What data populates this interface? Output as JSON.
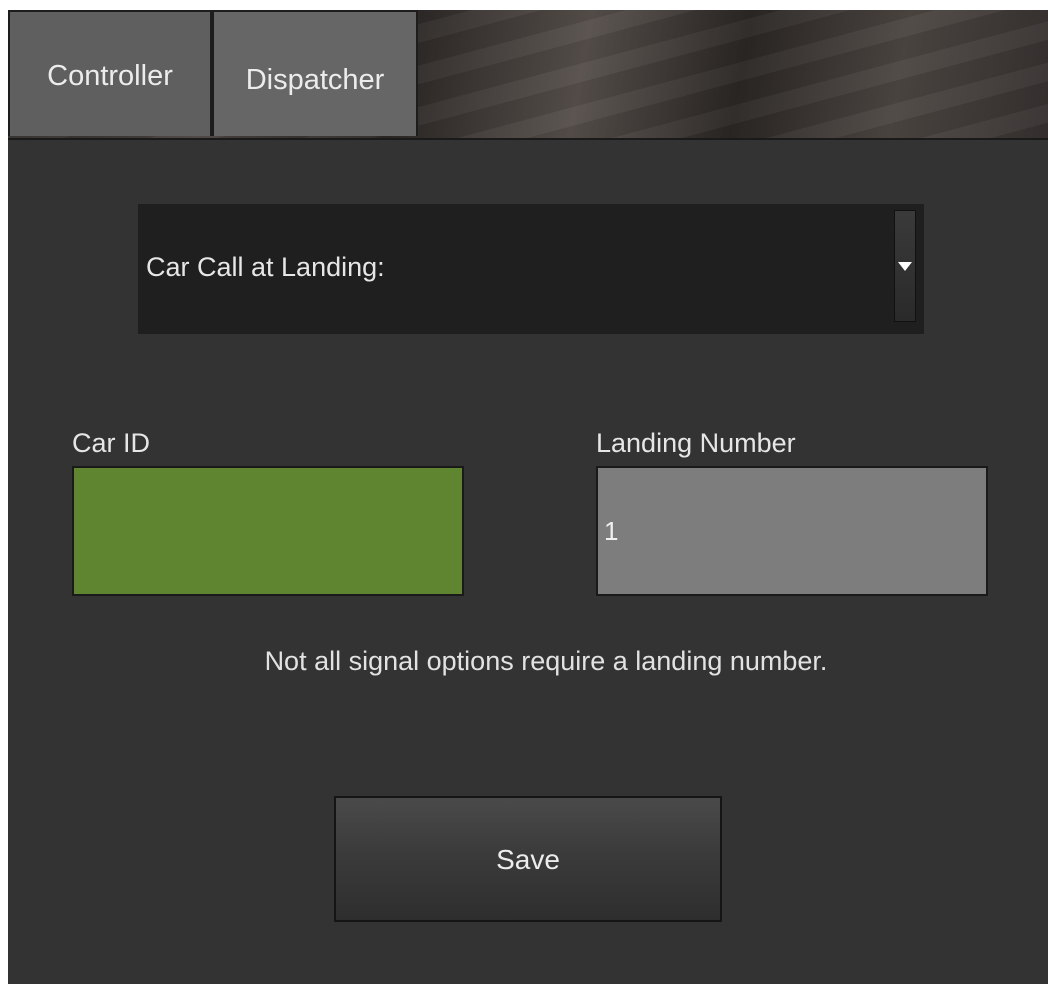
{
  "tabs": [
    {
      "label": "Controller",
      "active": false
    },
    {
      "label": "Dispatcher",
      "active": true
    }
  ],
  "signal_select": {
    "selected": "Car Call at Landing:"
  },
  "car_id": {
    "label": "Car ID",
    "value": "",
    "color": "#608531"
  },
  "landing_number": {
    "label": "Landing Number",
    "value": "1"
  },
  "hint_text": "Not all signal options require a landing number.",
  "save_button": {
    "label": "Save"
  }
}
